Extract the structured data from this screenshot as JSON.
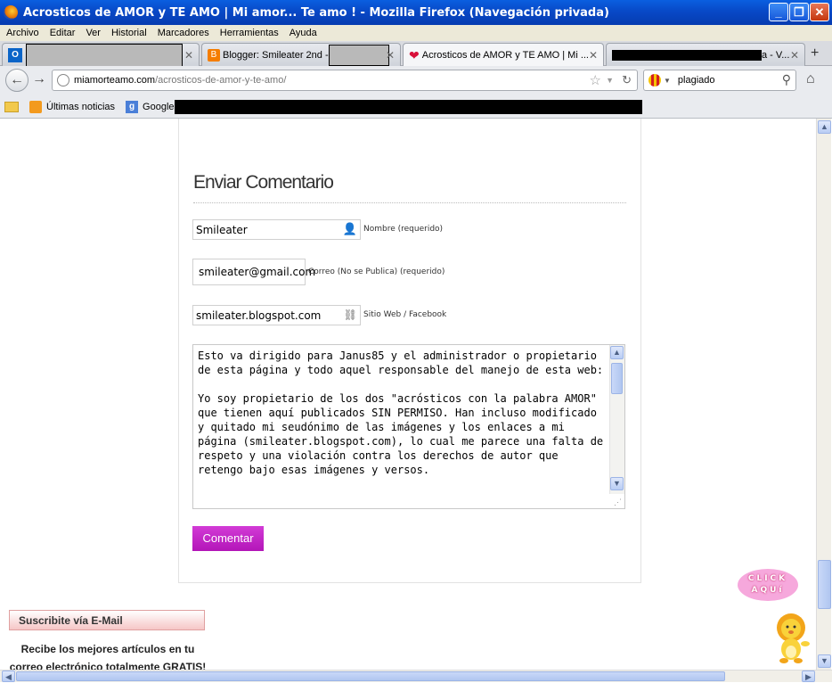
{
  "window": {
    "title": "Acrosticos de AMOR y TE AMO | Mi amor... Te amo ! - Mozilla Firefox (Navegación privada)",
    "minimize": "_",
    "maximize": "❐",
    "close": "✕"
  },
  "menu": [
    "Archivo",
    "Editar",
    "Ver",
    "Historial",
    "Marcadores",
    "Herramientas",
    "Ayuda"
  ],
  "tabs": [
    {
      "label": "",
      "redacted": true
    },
    {
      "label": "Blogger: Smileater 2nd -",
      "redacted_part": true
    },
    {
      "label": "Acrosticos de AMOR y TE AMO | Mi ...",
      "active": true
    },
    {
      "label": "a - V...",
      "redacted_part": true
    }
  ],
  "nav": {
    "url_domain": "miamorteamo.com",
    "url_path": "/acrosticos-de-amor-y-te-amo/",
    "search_value": "plagiado"
  },
  "bookmarks": [
    "Últimas noticias",
    "Google"
  ],
  "form": {
    "heading": "Enviar Comentario",
    "name_value": "Smileater",
    "name_label": "Nombre (requerido)",
    "email_value": "smileater@gmail.com",
    "email_label": "Correo (No se Publica) (requerido)",
    "web_value": "smileater.blogspot.com",
    "web_label": "Sitio Web / Facebook",
    "comment_text": "Esto va dirigido para Janus85 y el administrador o propietario de esta página y todo aquel responsable del manejo de esta web:\n\nYo soy propietario de los dos \"acrósticos con la palabra AMOR\" que tienen aquí publicados SIN PERMISO. Han incluso modificado y quitado mi seudónimo de las imágenes y los enlaces a mi página (smileater.blogspot.com), lo cual me parece una falta de respeto y una violación contra los derechos de autor que retengo bajo esas imágenes y versos.",
    "submit_label": "Comentar"
  },
  "sidebar": {
    "subscribe_title": "Suscribite vía E-Mail",
    "subscribe_text": "Recibe los mejores artículos en tu correo electrónico totalmente GRATIS!"
  },
  "widget": {
    "cloud_text_1": "CLICK",
    "cloud_text_2": "AQUí"
  }
}
